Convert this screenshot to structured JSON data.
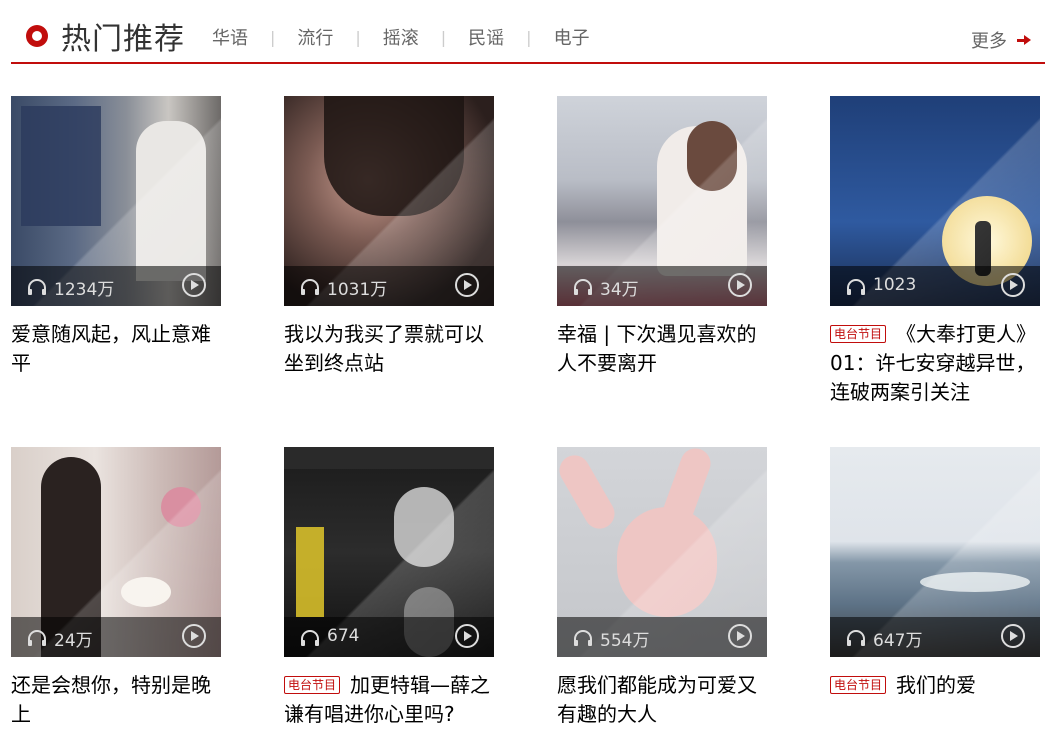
{
  "header": {
    "title": "热门推荐",
    "tabs": [
      "华语",
      "流行",
      "摇滚",
      "民谣",
      "电子"
    ],
    "more_label": "更多",
    "accent_color": "#c10d0c"
  },
  "playlists": [
    {
      "count": "1234万",
      "title": "爱意随风起，风止意难平",
      "badge": ""
    },
    {
      "count": "1031万",
      "title": "我以为我买了票就可以坐到终点站",
      "badge": ""
    },
    {
      "count": "34万",
      "title": "幸福 | 下次遇见喜欢的人不要离开",
      "badge": ""
    },
    {
      "count": "1023",
      "title": "《大奉打更人》01：许七安穿越异世，连破两案引关注",
      "badge": "电台节目"
    },
    {
      "count": "24万",
      "title": "还是会想你，特别是晚上",
      "badge": ""
    },
    {
      "count": "674",
      "title": "加更特辑—薛之谦有唱进你心里吗?",
      "badge": "电台节目"
    },
    {
      "count": "554万",
      "title": "愿我们都能成为可爱又有趣的大人",
      "badge": ""
    },
    {
      "count": "647万",
      "title": "我们的爱",
      "badge": "电台节目"
    }
  ]
}
